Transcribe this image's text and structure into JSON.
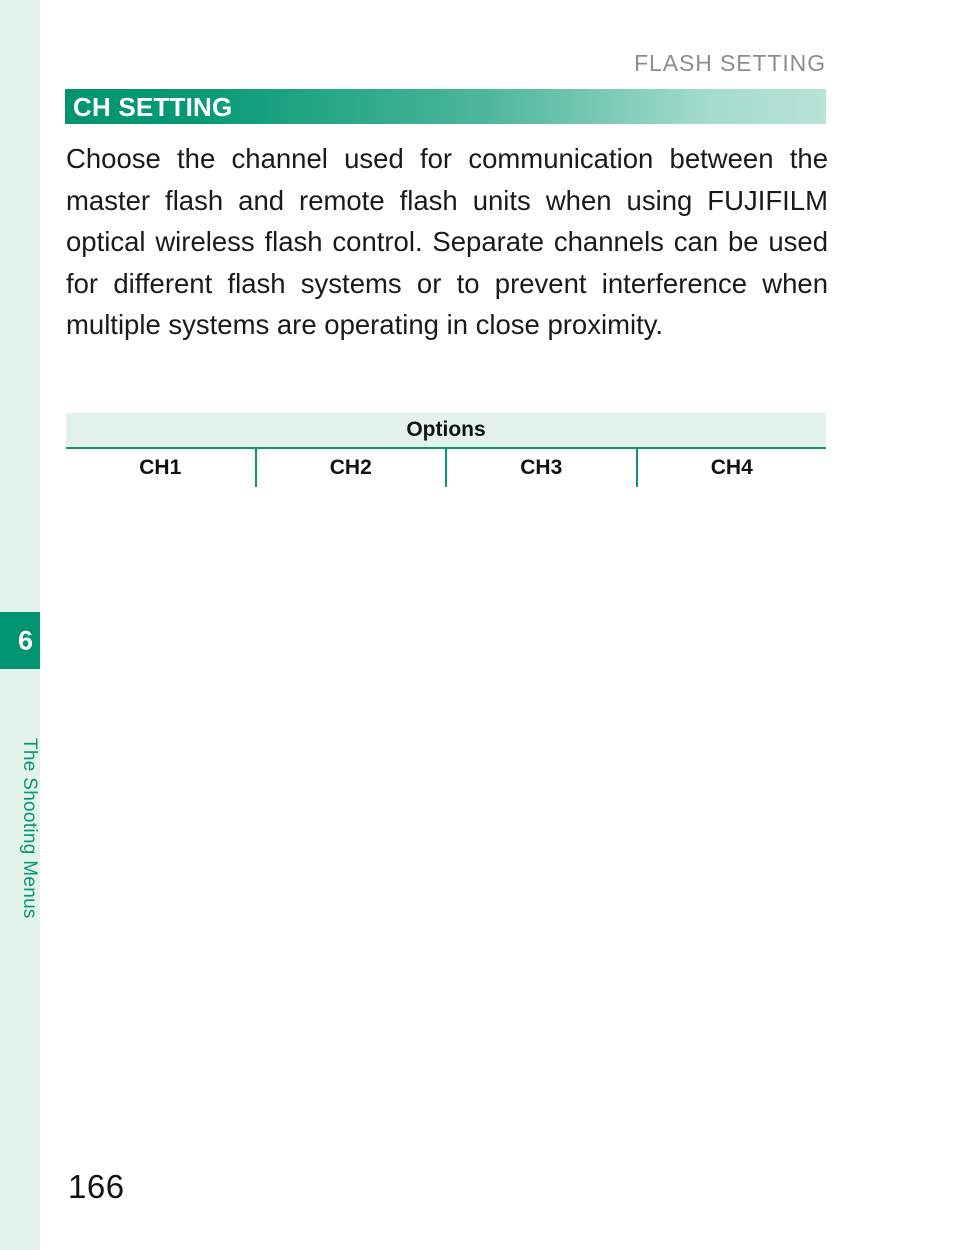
{
  "sidebar": {
    "chapter_number": "6",
    "chapter_label": "The Shooting Menus",
    "band_color": "#e4f2ec",
    "box_color": "#009470",
    "label_color": "#0a9673"
  },
  "header": {
    "running_title": "FLASH SETTING",
    "running_title_color": "#8d8d8d"
  },
  "section": {
    "title": "CH SETTING",
    "bar_gradient_start": "#009470",
    "bar_gradient_end": "#b8e3d7",
    "title_color": "#ffffff"
  },
  "body": {
    "paragraph": "Choose the channel used for communication between the master flash and remote flash units when using FUJIFILM optical wireless flash control. Separate channels can be used for different flash systems or to prevent interference when multiple systems are operating in close proximity."
  },
  "options_table": {
    "header_label": "Options",
    "header_bg": "#e4f2ec",
    "rule_color": "#0a9673",
    "cells": [
      {
        "label": "CH1"
      },
      {
        "label": "CH2"
      },
      {
        "label": "CH3"
      },
      {
        "label": "CH4"
      }
    ]
  },
  "footer": {
    "page_number": "166"
  }
}
